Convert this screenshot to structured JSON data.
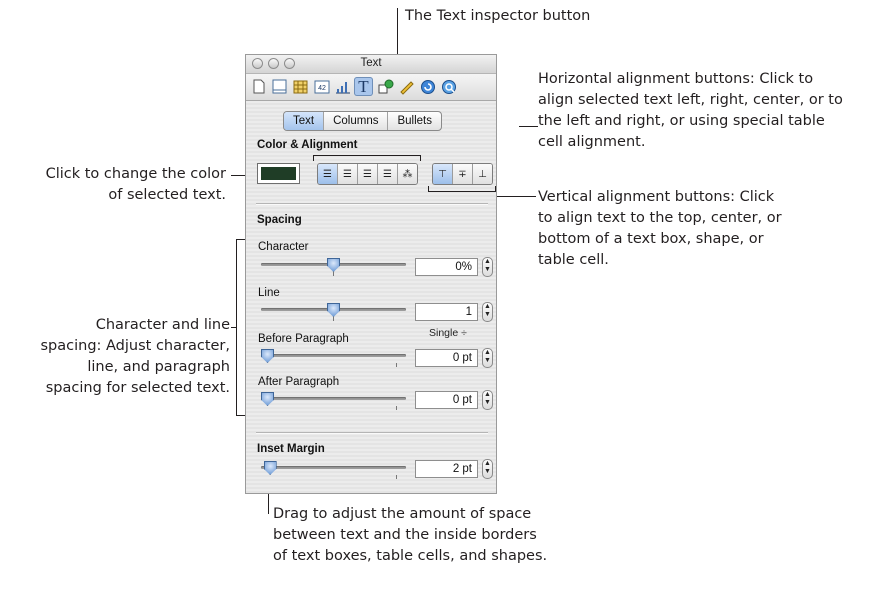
{
  "callouts": {
    "inspector_button": "The Text inspector button",
    "horizontal": [
      "Horizontal alignment buttons:  Click to",
      "align selected text left, right, center, or to",
      "the left and right, or using special table",
      "cell alignment."
    ],
    "color": [
      "Click to change the color",
      "of selected text."
    ],
    "vertical": [
      "Vertical alignment buttons:  Click",
      "to align text to the top, center, or",
      "bottom of a text box, shape, or",
      "table cell."
    ],
    "spacing": [
      "Character and line",
      "spacing:  Adjust character,",
      "line, and paragraph",
      "spacing for selected text."
    ],
    "inset": [
      "Drag to adjust the amount of space",
      "between text and the inside borders",
      "of text boxes, table cells, and shapes."
    ]
  },
  "window": {
    "title": "Text",
    "toolbar_icons": [
      "document-icon",
      "layout-icon",
      "table-icon",
      "graphic-icon",
      "chart-icon",
      "text-inspector-icon",
      "shape-icon",
      "ruler-icon",
      "link-icon",
      "quicktime-icon"
    ],
    "toolbar_glyphs": {
      "text": "T",
      "graphic": "42"
    },
    "active_toolbar": "text-inspector-icon",
    "tabs": [
      "Text",
      "Columns",
      "Bullets"
    ],
    "active_tab": "Text",
    "color_alignment": {
      "heading": "Color & Alignment",
      "swatch_color": "#1f3d26",
      "horizontal_buttons": [
        "align-left-icon",
        "align-center-icon",
        "align-right-icon",
        "justify-icon",
        "auto-align-icon"
      ],
      "horizontal_glyphs": [
        "☰",
        "☰",
        "☰",
        "☰",
        "⁂"
      ],
      "selected_horizontal": "align-left-icon",
      "vertical_buttons": [
        "align-top-icon",
        "align-middle-icon",
        "align-bottom-icon"
      ],
      "vertical_glyphs": [
        "⊤",
        "∓",
        "⊥"
      ],
      "selected_vertical": "align-top-icon"
    },
    "spacing": {
      "heading": "Spacing",
      "character": {
        "label": "Character",
        "value": "0%",
        "level": 0.5
      },
      "line": {
        "label": "Line",
        "value": "1",
        "level": 0.5,
        "mode": "Single ÷"
      },
      "before_paragraph": {
        "label": "Before Paragraph",
        "value": "0 pt",
        "level": 0.0
      },
      "after_paragraph": {
        "label": "After Paragraph",
        "value": "0 pt",
        "level": 0.0
      }
    },
    "inset_margin": {
      "heading": "Inset Margin",
      "value": "2 pt",
      "level": 0.02
    },
    "stepper_glyphs": [
      "▲",
      "▼"
    ]
  }
}
